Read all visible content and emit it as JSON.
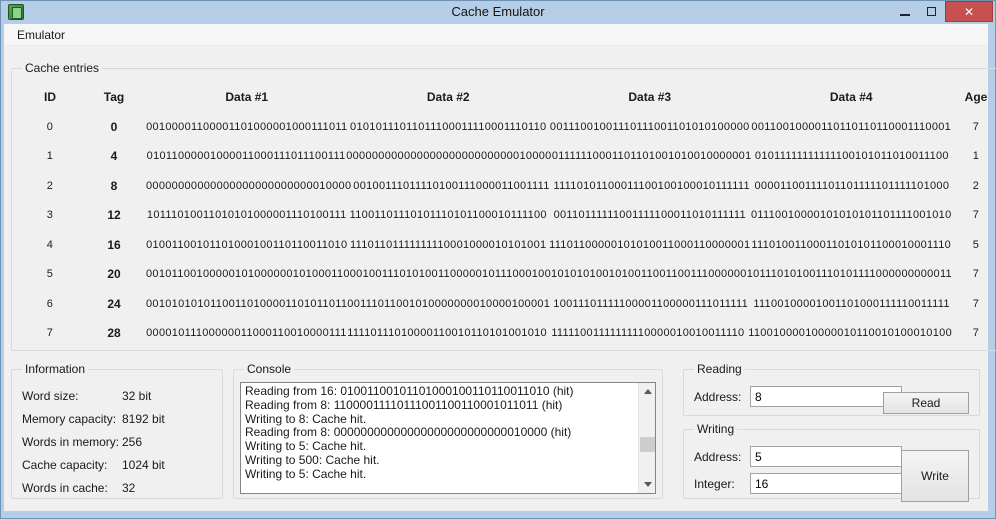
{
  "window": {
    "title": "Cache Emulator",
    "close_glyph": "✕"
  },
  "menu": {
    "items": [
      {
        "label": "Emulator"
      }
    ]
  },
  "cache_entries": {
    "title": "Cache entries",
    "columns": [
      "ID",
      "Tag",
      "Data #1",
      "Data #2",
      "Data #3",
      "Data #4",
      "Age"
    ],
    "rows": [
      {
        "id": "0",
        "tag": "0",
        "data1": "00100001100001101000001000111011",
        "data2": "01010111011011100011110001110110",
        "data3": "00111001001110111001101010100000",
        "data4": "00110010000110110110110001110001",
        "age": "7"
      },
      {
        "id": "1",
        "tag": "4",
        "data1": "01011000001000011000111011100111",
        "data2": "00000000000000000000000000010000",
        "data3": "01111110001101101001010010000001",
        "data4": "01011111111111100101011010011100",
        "age": "1"
      },
      {
        "id": "2",
        "tag": "8",
        "data1": "00000000000000000000000000010000",
        "data2": "00100111011110100111000011001111",
        "data3": "11110101100011100100100010111111",
        "data4": "00001100111101101111101111101000",
        "age": "2"
      },
      {
        "id": "3",
        "tag": "12",
        "data1": "10111010011010101000001110100111",
        "data2": "11001101110101110101100010111100",
        "data3": "00110111111001111100011010111111",
        "data4": "01110010000101010101101111001010",
        "age": "7"
      },
      {
        "id": "4",
        "tag": "16",
        "data1": "01001100101101000100110110011010",
        "data2": "11101101111111110001000010101001",
        "data3": "11101100000101010011000110000001",
        "data4": "11101001100011010101100010001110",
        "age": "5"
      },
      {
        "id": "5",
        "tag": "20",
        "data1": "00101100100000101000000101000110",
        "data2": "00100111010100110000010111000100",
        "data3": "10101010010100110011001110000001",
        "data4": "01110101001110101111000000000011",
        "age": "7"
      },
      {
        "id": "6",
        "tag": "24",
        "data1": "00101010101100110100001101011011",
        "data2": "00111011001010000000010000100001",
        "data3": "10011101111100001100000111011111",
        "data4": "11100100001001101000111110011111",
        "age": "7"
      },
      {
        "id": "7",
        "tag": "28",
        "data1": "00001011100000011000110010000111",
        "data2": "11110111010000110010110101001010",
        "data3": "11111001111111110000010010011110",
        "data4": "11001000010000010110010100010100",
        "age": "7"
      }
    ]
  },
  "information": {
    "title": "Information",
    "fields": [
      {
        "label": "Word size:",
        "value": "32 bit"
      },
      {
        "label": "Memory capacity:",
        "value": "8192 bit"
      },
      {
        "label": "Words in memory:",
        "value": "256"
      },
      {
        "label": "Cache capacity:",
        "value": "1024 bit"
      },
      {
        "label": "Words in cache:",
        "value": "32"
      }
    ]
  },
  "console": {
    "title": "Console",
    "lines": [
      "Reading from 16: 01001100101101000100110110011010 (hit)",
      "Reading from 8: 11000011110111001100110001011011 (hit)",
      "Writing to 8: Cache hit.",
      "Reading from 8: 00000000000000000000000000010000 (hit)",
      "Writing to 5: Cache hit.",
      "Writing to 500: Cache hit.",
      "Writing to 5: Cache hit."
    ]
  },
  "reading": {
    "title": "Reading",
    "address_label": "Address:",
    "address_value": "8",
    "read_button": "Read"
  },
  "writing": {
    "title": "Writing",
    "address_label": "Address:",
    "address_value": "5",
    "integer_label": "Integer:",
    "integer_value": "16",
    "write_button": "Write"
  },
  "colors": {
    "titlebar": "#b5cde7",
    "frame_border": "#6e93b4",
    "close_button": "#c75050",
    "client_background": "#f0f0f0",
    "console_background": "#ffffff"
  }
}
